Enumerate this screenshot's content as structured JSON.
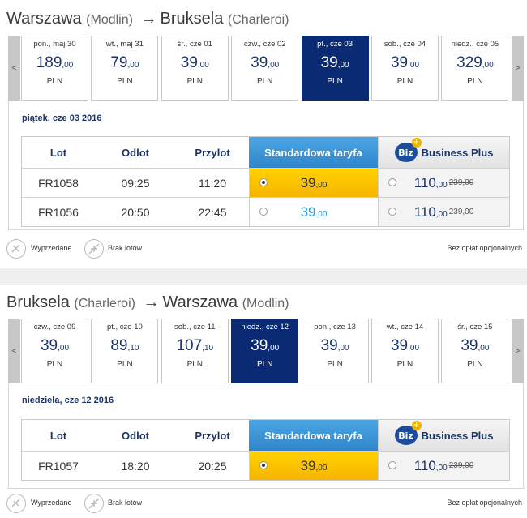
{
  "outbound": {
    "origin": "Warszawa",
    "origin_sub": "(Modlin)",
    "arrow": "→",
    "destination": "Bruksela",
    "destination_sub": "(Charleroi)",
    "nav_prev": "<",
    "nav_next": ">",
    "dates": [
      {
        "label": "pon., maj 30",
        "price": "189",
        "dec": ",00",
        "currency": "PLN"
      },
      {
        "label": "wt., maj 31",
        "price": "79",
        "dec": ",00",
        "currency": "PLN"
      },
      {
        "label": "śr., cze 01",
        "price": "39",
        "dec": ",00",
        "currency": "PLN"
      },
      {
        "label": "czw., cze 02",
        "price": "39",
        "dec": ",00",
        "currency": "PLN"
      },
      {
        "label": "pt., cze 03",
        "price": "39",
        "dec": ",00",
        "currency": "PLN"
      },
      {
        "label": "sob., cze 04",
        "price": "39",
        "dec": ",00",
        "currency": "PLN"
      },
      {
        "label": "niedz., cze 05",
        "price": "329",
        "dec": ",00",
        "currency": "PLN"
      }
    ],
    "selected_date_index": 4,
    "day_heading": "piątek, cze 03 2016",
    "table": {
      "col_flight": "Lot",
      "col_departure": "Odlot",
      "col_arrival": "Przylot",
      "col_standard": "Standardowa taryfa",
      "col_business": "Business Plus",
      "biz_logo": "Biz",
      "rows": [
        {
          "flight": "FR1058",
          "departure": "09:25",
          "arrival": "11:20",
          "std_price": "39",
          "std_dec": ",00",
          "biz_price": "110",
          "biz_dec": ",00",
          "biz_old": "239,00",
          "std_selected": true
        },
        {
          "flight": "FR1056",
          "departure": "20:50",
          "arrival": "22:45",
          "std_price": "39",
          "std_dec": ",00",
          "biz_price": "110",
          "biz_dec": ",00",
          "biz_old": "239,00",
          "std_selected": false
        }
      ]
    },
    "legend": {
      "sold_out": "Wyprzedane",
      "no_flights": "Brak lotów",
      "note": "Bez opłat opcjonalnych"
    }
  },
  "inbound": {
    "origin": "Bruksela",
    "origin_sub": "(Charleroi)",
    "arrow": "→",
    "destination": "Warszawa",
    "destination_sub": "(Modlin)",
    "nav_prev": "<",
    "nav_next": ">",
    "dates": [
      {
        "label": "czw., cze 09",
        "price": "39",
        "dec": ",00",
        "currency": "PLN"
      },
      {
        "label": "pt., cze 10",
        "price": "89",
        "dec": ",10",
        "currency": "PLN"
      },
      {
        "label": "sob., cze 11",
        "price": "107",
        "dec": ",10",
        "currency": "PLN"
      },
      {
        "label": "niedz., cze 12",
        "price": "39",
        "dec": ",00",
        "currency": "PLN"
      },
      {
        "label": "pon., cze 13",
        "price": "39",
        "dec": ",00",
        "currency": "PLN"
      },
      {
        "label": "wt., cze 14",
        "price": "39",
        "dec": ",00",
        "currency": "PLN"
      },
      {
        "label": "śr., cze 15",
        "price": "39",
        "dec": ",00",
        "currency": "PLN"
      }
    ],
    "selected_date_index": 3,
    "day_heading": "niedziela, cze 12 2016",
    "table": {
      "col_flight": "Lot",
      "col_departure": "Odlot",
      "col_arrival": "Przylot",
      "col_standard": "Standardowa taryfa",
      "col_business": "Business Plus",
      "biz_logo": "Biz",
      "rows": [
        {
          "flight": "FR1057",
          "departure": "18:20",
          "arrival": "20:25",
          "std_price": "39",
          "std_dec": ",00",
          "biz_price": "110",
          "biz_dec": ",00",
          "biz_old": "239,00",
          "std_selected": true
        }
      ]
    },
    "legend": {
      "sold_out": "Wyprzedane",
      "no_flights": "Brak lotów",
      "note": "Bez opłat opcjonalnych"
    }
  },
  "colors": {
    "selected_date": "#0a2a73",
    "standard_header": "#3b96d8",
    "selected_fare": "#ffd100",
    "price_text": "#1b3468"
  }
}
